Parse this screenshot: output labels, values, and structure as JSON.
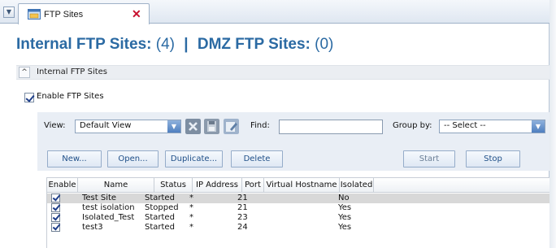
{
  "tab": {
    "label": "FTP Sites",
    "close_symbol": "✕"
  },
  "title": {
    "internal_label": "Internal FTP Sites:",
    "internal_count": "(4)",
    "separator": "|",
    "dmz_label": "DMZ FTP Sites:",
    "dmz_count": "(0)"
  },
  "section": {
    "label": "Internal FTP Sites",
    "toggle": "^"
  },
  "enable": {
    "label": "Enable FTP Sites",
    "checked": true
  },
  "toolbar": {
    "view_label": "View:",
    "view_value": "Default View",
    "find_label": "Find:",
    "find_value": "",
    "groupby_label": "Group by:",
    "groupby_value": "-- Select --"
  },
  "buttons": {
    "new": "New...",
    "open": "Open...",
    "duplicate": "Duplicate...",
    "delete": "Delete",
    "start": "Start",
    "stop": "Stop"
  },
  "table": {
    "columns": [
      "Enable",
      "Name",
      "Status",
      "IP Address",
      "Port",
      "Virtual Hostname",
      "Isolated"
    ],
    "rows": [
      {
        "enabled": true,
        "name": "Test Site",
        "status": "Started",
        "ip": "*",
        "port": "21",
        "vhost": "",
        "isolated": "No"
      },
      {
        "enabled": true,
        "name": "test isolation",
        "status": "Stopped",
        "ip": "*",
        "port": "21",
        "vhost": "",
        "isolated": "Yes"
      },
      {
        "enabled": true,
        "name": "Isolated_Test",
        "status": "Started",
        "ip": "*",
        "port": "23",
        "vhost": "",
        "isolated": "Yes"
      },
      {
        "enabled": true,
        "name": "test3",
        "status": "Started",
        "ip": "*",
        "port": "24",
        "vhost": "",
        "isolated": "Yes"
      }
    ]
  },
  "colors": {
    "title": "#2b6aa3",
    "close": "#c8102e",
    "panel": "#e9eef5",
    "selected_row": "#d8d8d8"
  }
}
